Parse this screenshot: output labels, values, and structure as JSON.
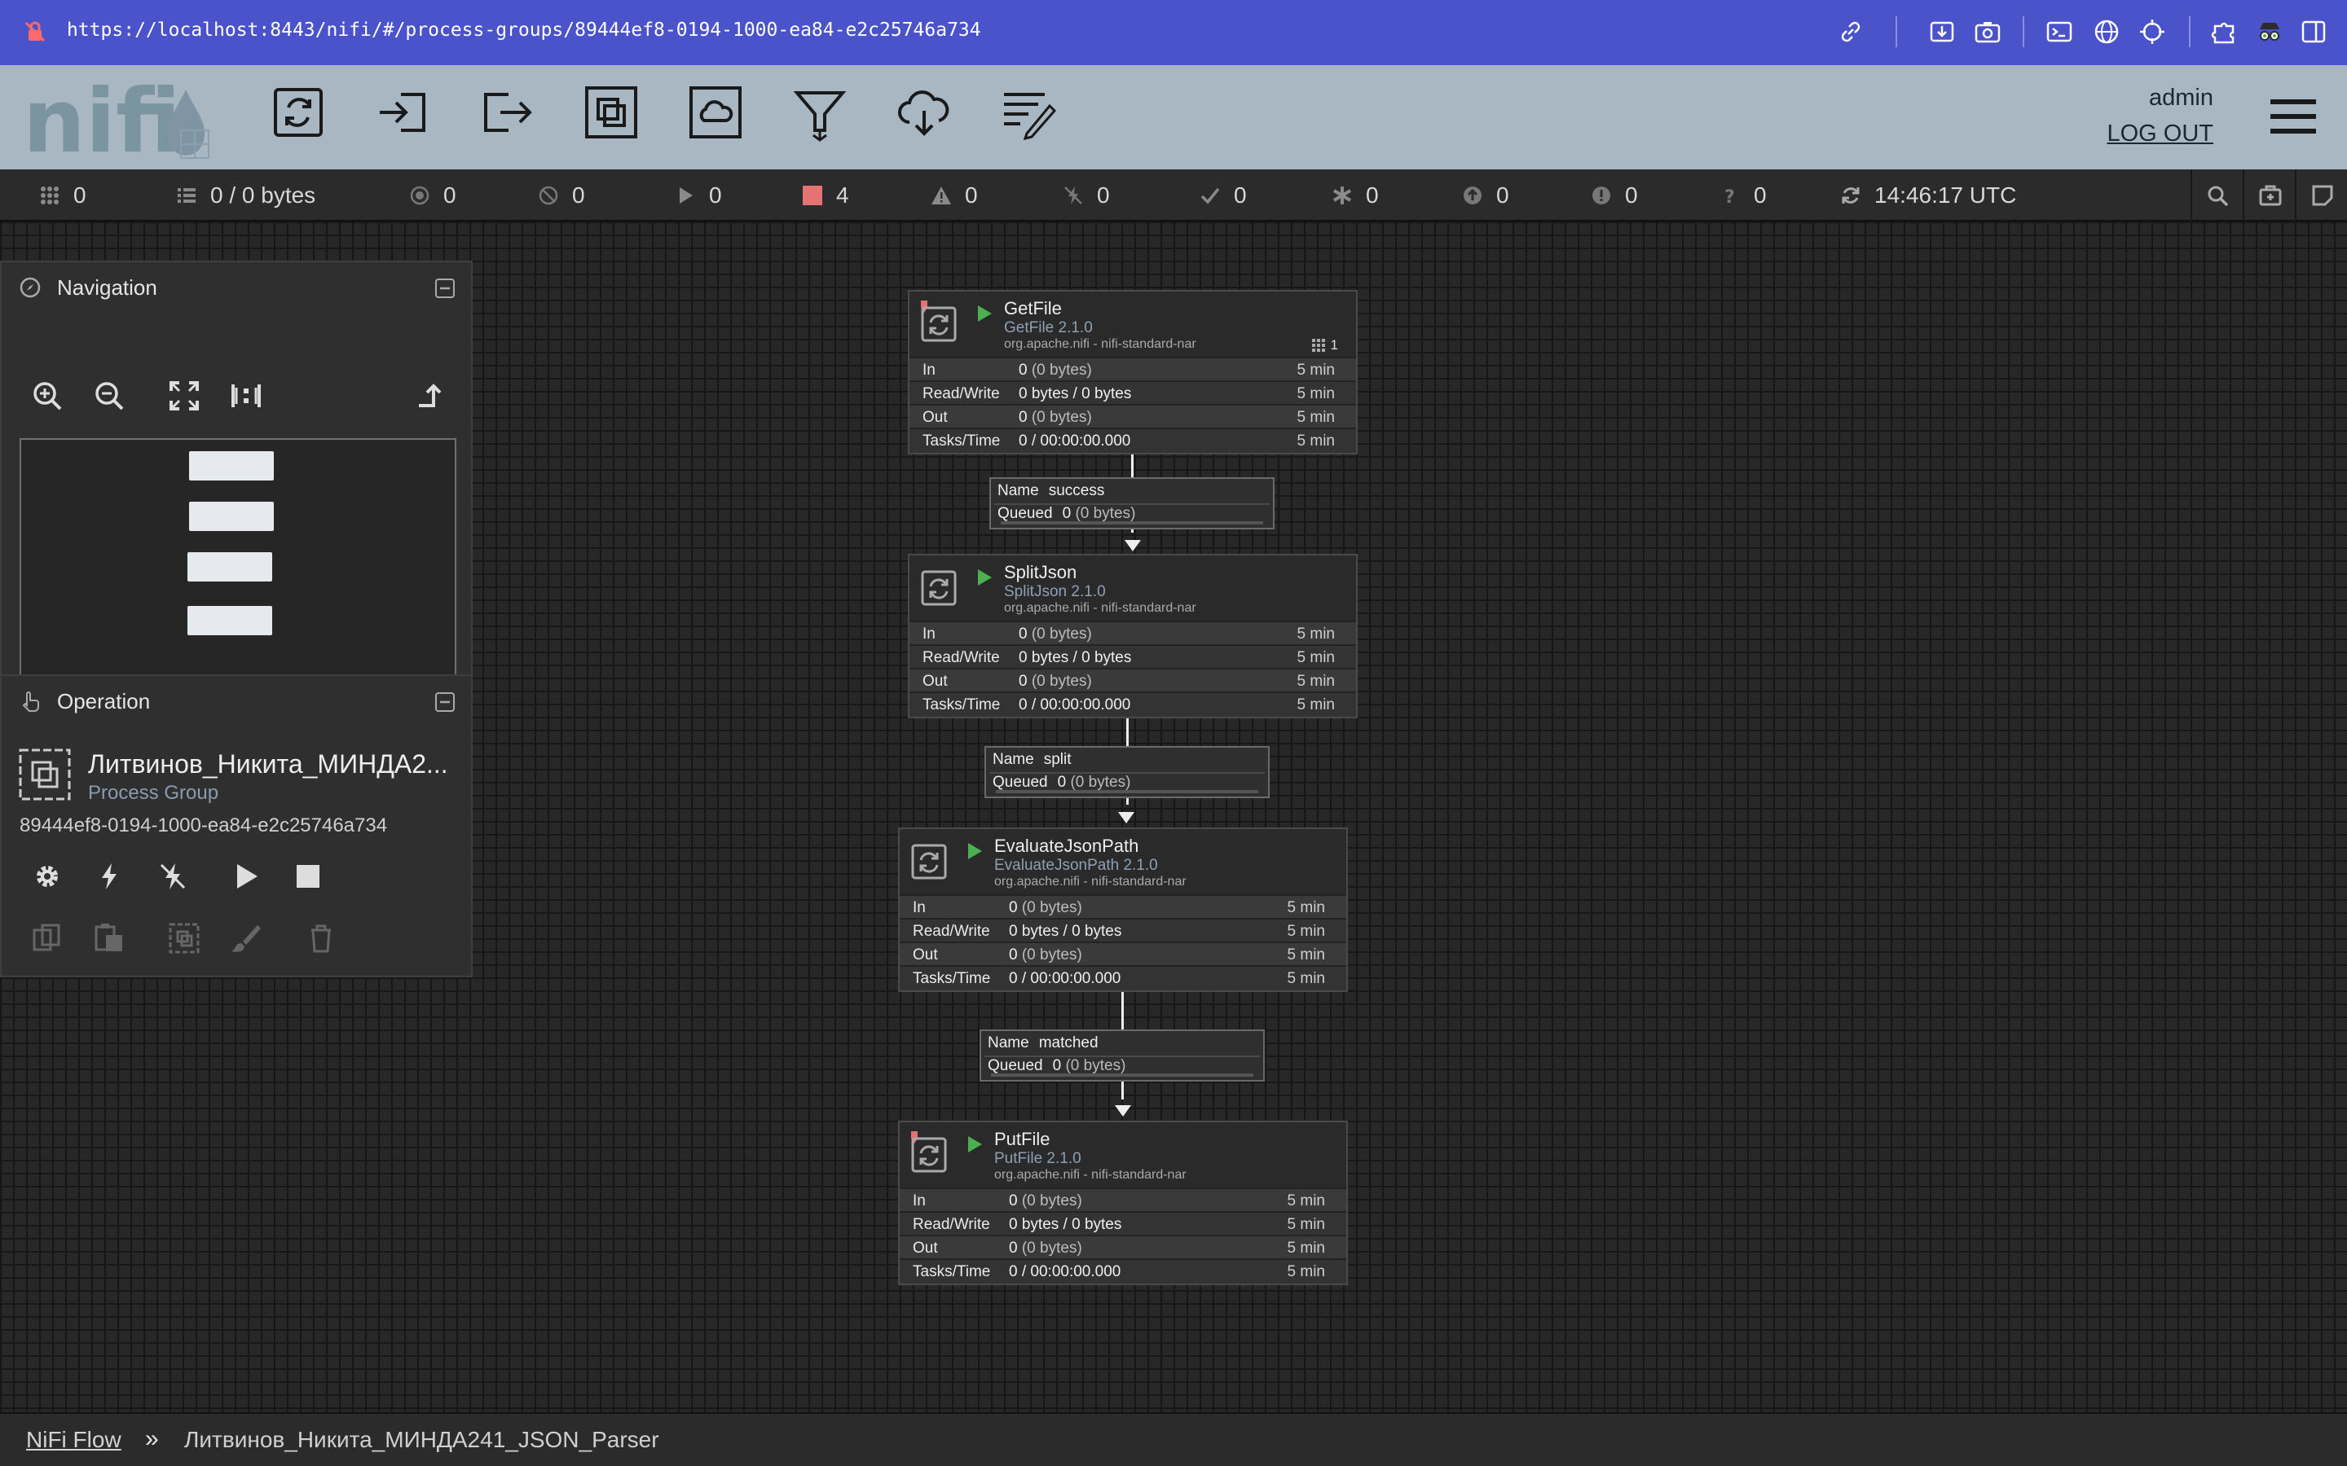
{
  "browser": {
    "url": "https://localhost:8443/nifi/#/process-groups/89444ef8-0194-1000-ea84-e2c25746a734"
  },
  "header": {
    "logo_text": "nifi",
    "user": "admin",
    "logout_label": "LOG OUT",
    "toolbar": [
      "processor-tool",
      "input-port-tool",
      "output-port-tool",
      "process-group-tool",
      "remote-process-group-tool",
      "funnel-tool",
      "template-tool",
      "label-tool"
    ]
  },
  "status": {
    "cluster": "0",
    "queued": "0 / 0 bytes",
    "transmitting": "0",
    "not_transmitting": "0",
    "running": "0",
    "stopped": "4",
    "invalid": "0",
    "disabled": "0",
    "up_to_date": "0",
    "locally_modified": "0",
    "stale": "0",
    "modified_stale": "0",
    "sync_failure": "0",
    "refreshed": "14:46:17 UTC"
  },
  "navigation": {
    "title": "Navigation"
  },
  "operation": {
    "title": "Operation",
    "name": "Литвинов_Никита_МИНДА2...",
    "type": "Process Group",
    "id": "89444ef8-0194-1000-ea84-e2c25746a734"
  },
  "row_labels": {
    "in": "In",
    "rw": "Read/Write",
    "out": "Out",
    "tasks": "Tasks/Time"
  },
  "processors": [
    {
      "name": "GetFile",
      "version": "GetFile 2.1.0",
      "bundle": "org.apache.nifi - nifi-standard-nar",
      "badge": "1",
      "in_value": "0",
      "in_sub": "(0 bytes)",
      "rw": "0 bytes / 0 bytes",
      "out_value": "0",
      "out_sub": "(0 bytes)",
      "tasks": "0 / 00:00:00.000",
      "window": "5 min"
    },
    {
      "name": "SplitJson",
      "version": "SplitJson 2.1.0",
      "bundle": "org.apache.nifi - nifi-standard-nar",
      "in_value": "0",
      "in_sub": "(0 bytes)",
      "rw": "0 bytes / 0 bytes",
      "out_value": "0",
      "out_sub": "(0 bytes)",
      "tasks": "0 / 00:00:00.000",
      "window": "5 min"
    },
    {
      "name": "EvaluateJsonPath",
      "version": "EvaluateJsonPath 2.1.0",
      "bundle": "org.apache.nifi - nifi-standard-nar",
      "in_value": "0",
      "in_sub": "(0 bytes)",
      "rw": "0 bytes / 0 bytes",
      "out_value": "0",
      "out_sub": "(0 bytes)",
      "tasks": "0 / 00:00:00.000",
      "window": "5 min"
    },
    {
      "name": "PutFile",
      "version": "PutFile 2.1.0",
      "bundle": "org.apache.nifi - nifi-standard-nar",
      "in_value": "0",
      "in_sub": "(0 bytes)",
      "rw": "0 bytes / 0 bytes",
      "out_value": "0",
      "out_sub": "(0 bytes)",
      "tasks": "0 / 00:00:00.000",
      "window": "5 min"
    }
  ],
  "conn_labels": {
    "name": "Name",
    "queued": "Queued"
  },
  "connections": [
    {
      "name": "success",
      "queued_value": "0",
      "queued_sub": "(0 bytes)"
    },
    {
      "name": "split",
      "queued_value": "0",
      "queued_sub": "(0 bytes)"
    },
    {
      "name": "matched",
      "queued_value": "0",
      "queued_sub": "(0 bytes)"
    }
  ],
  "breadcrumb": {
    "root": "NiFi Flow",
    "separator": "»",
    "current": "Литвинов_Никита_МИНДА241_JSON_Parser"
  },
  "colors": {
    "urlbar": "#4a53c9",
    "header": "#a9b7c2",
    "run": "#4caf50",
    "stopped": "#e57373"
  }
}
